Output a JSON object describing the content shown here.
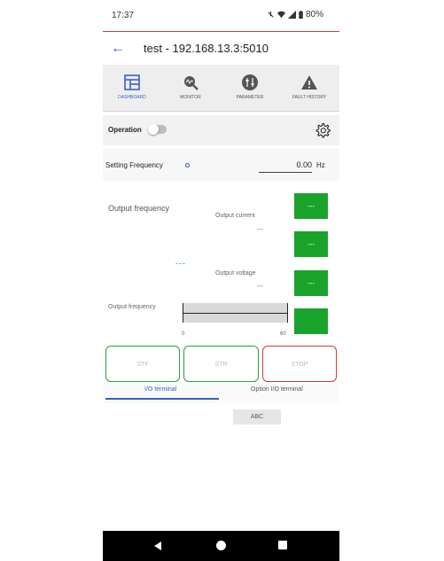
{
  "status_bar": {
    "time": "17:37",
    "battery": "80%",
    "icons": [
      "mute-icon",
      "wifi-icon",
      "signal-icon",
      "battery-icon"
    ]
  },
  "app_bar": {
    "title": "test - 192.168.13.3:5010"
  },
  "tabs": [
    {
      "label": "Dashboard",
      "icon": "dashboard-icon",
      "active": true
    },
    {
      "label": "Monitor",
      "icon": "monitor-icon",
      "active": false
    },
    {
      "label": "Parameter",
      "icon": "parameter-icon",
      "active": false
    },
    {
      "label": "Fault history",
      "icon": "warning-icon",
      "active": false
    }
  ],
  "operation": {
    "label": "Operation",
    "on": false
  },
  "setting_frequency": {
    "label": "Setting Frequency",
    "value": "0.00",
    "unit": "Hz"
  },
  "monitor": {
    "output_frequency_title": "Output frequency",
    "output_frequency_value": "---",
    "output_current_label": "Output current",
    "output_current_value": "---",
    "output_voltage_label": "Output voltage",
    "output_voltage_value": "---",
    "boxes": [
      "---",
      "---",
      "---",
      ""
    ],
    "bar_label": "Output frequency",
    "bar_min": "0",
    "bar_max": "60"
  },
  "buttons": {
    "stf": "STF",
    "str": "STR",
    "stop": "STOP"
  },
  "subtabs": {
    "io": "I/O terminal",
    "option_io": "Option I/O terminal"
  },
  "abc_label": "ABC",
  "colors": {
    "accent": "#3a5fc8",
    "green": "#1aa32a",
    "red": "#d23a3a"
  }
}
